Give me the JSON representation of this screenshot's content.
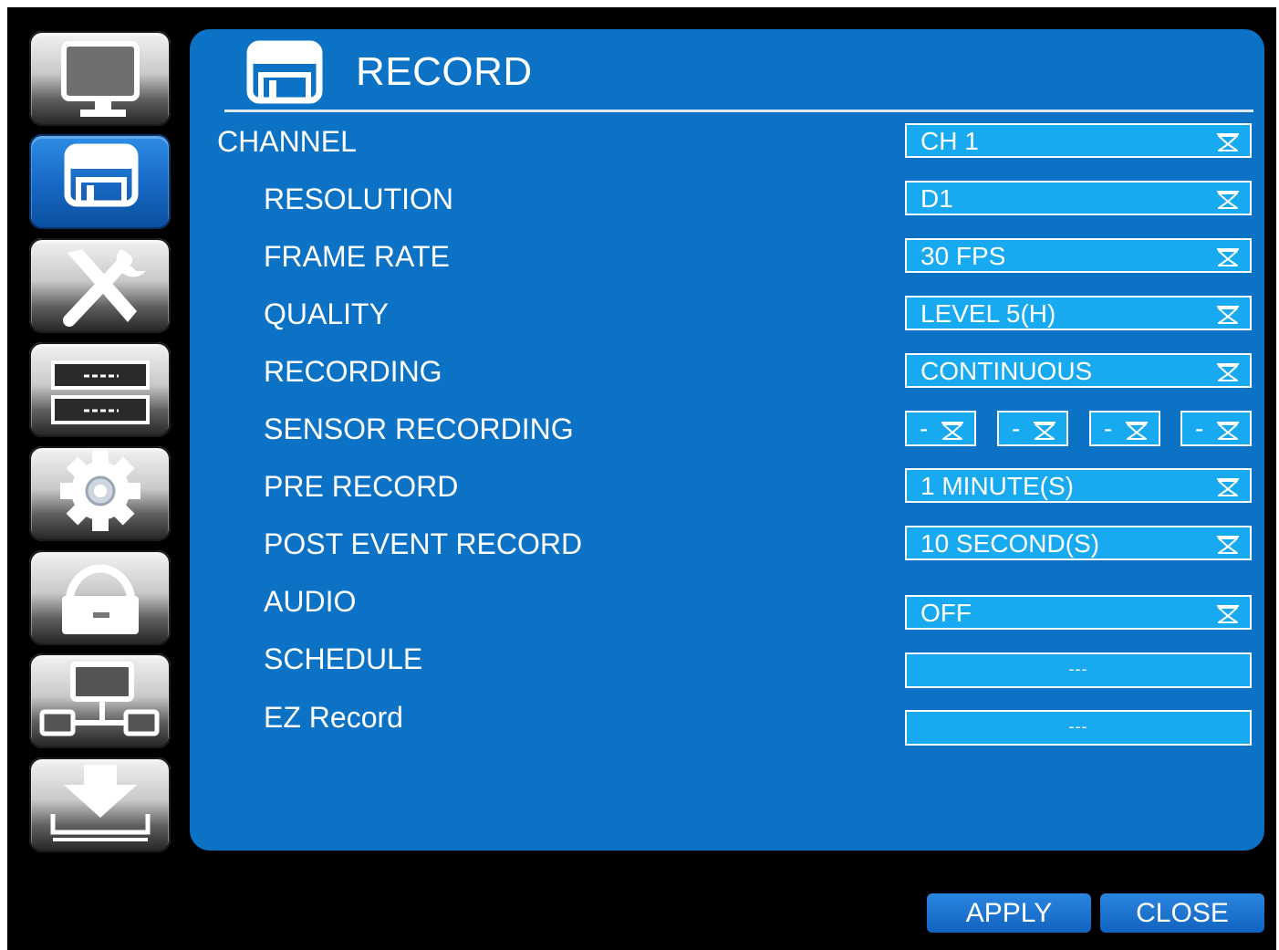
{
  "page": {
    "title": "RECORD"
  },
  "sidebar": {
    "items": [
      {
        "icon": "monitor-icon",
        "active": false
      },
      {
        "icon": "floppy-disk-icon",
        "active": true
      },
      {
        "icon": "tools-icon",
        "active": false
      },
      {
        "icon": "storage-drives-icon",
        "active": false
      },
      {
        "icon": "gear-icon",
        "active": false
      },
      {
        "icon": "lock-icon",
        "active": false
      },
      {
        "icon": "network-icon",
        "active": false
      },
      {
        "icon": "download-icon",
        "active": false
      }
    ]
  },
  "settings": {
    "channel": {
      "label": "CHANNEL",
      "value": "CH 1"
    },
    "resolution": {
      "label": "RESOLUTION",
      "value": "D1"
    },
    "frame_rate": {
      "label": "FRAME RATE",
      "value": "30 FPS"
    },
    "quality": {
      "label": "QUALITY",
      "value": "LEVEL 5(H)"
    },
    "recording": {
      "label": "RECORDING",
      "value": "CONTINUOUS"
    },
    "sensor_recording": {
      "label": "SENSOR RECORDING",
      "values": [
        "-",
        "-",
        "-",
        "-"
      ]
    },
    "pre_record": {
      "label": "PRE RECORD",
      "value": "1 MINUTE(S)"
    },
    "post_event_record": {
      "label": "POST EVENT RECORD",
      "value": "10 SECOND(S)"
    },
    "audio": {
      "label": "AUDIO",
      "value": "OFF"
    },
    "schedule": {
      "label": "SCHEDULE",
      "value": "---"
    },
    "ez_record": {
      "label": "EZ Record",
      "value": "---"
    }
  },
  "footer": {
    "apply_label": "APPLY",
    "close_label": "CLOSE"
  },
  "colors": {
    "panel": "#0b72c6",
    "field": "#18aaf0",
    "active_sidebar": "#1667c2",
    "background": "#000000"
  }
}
